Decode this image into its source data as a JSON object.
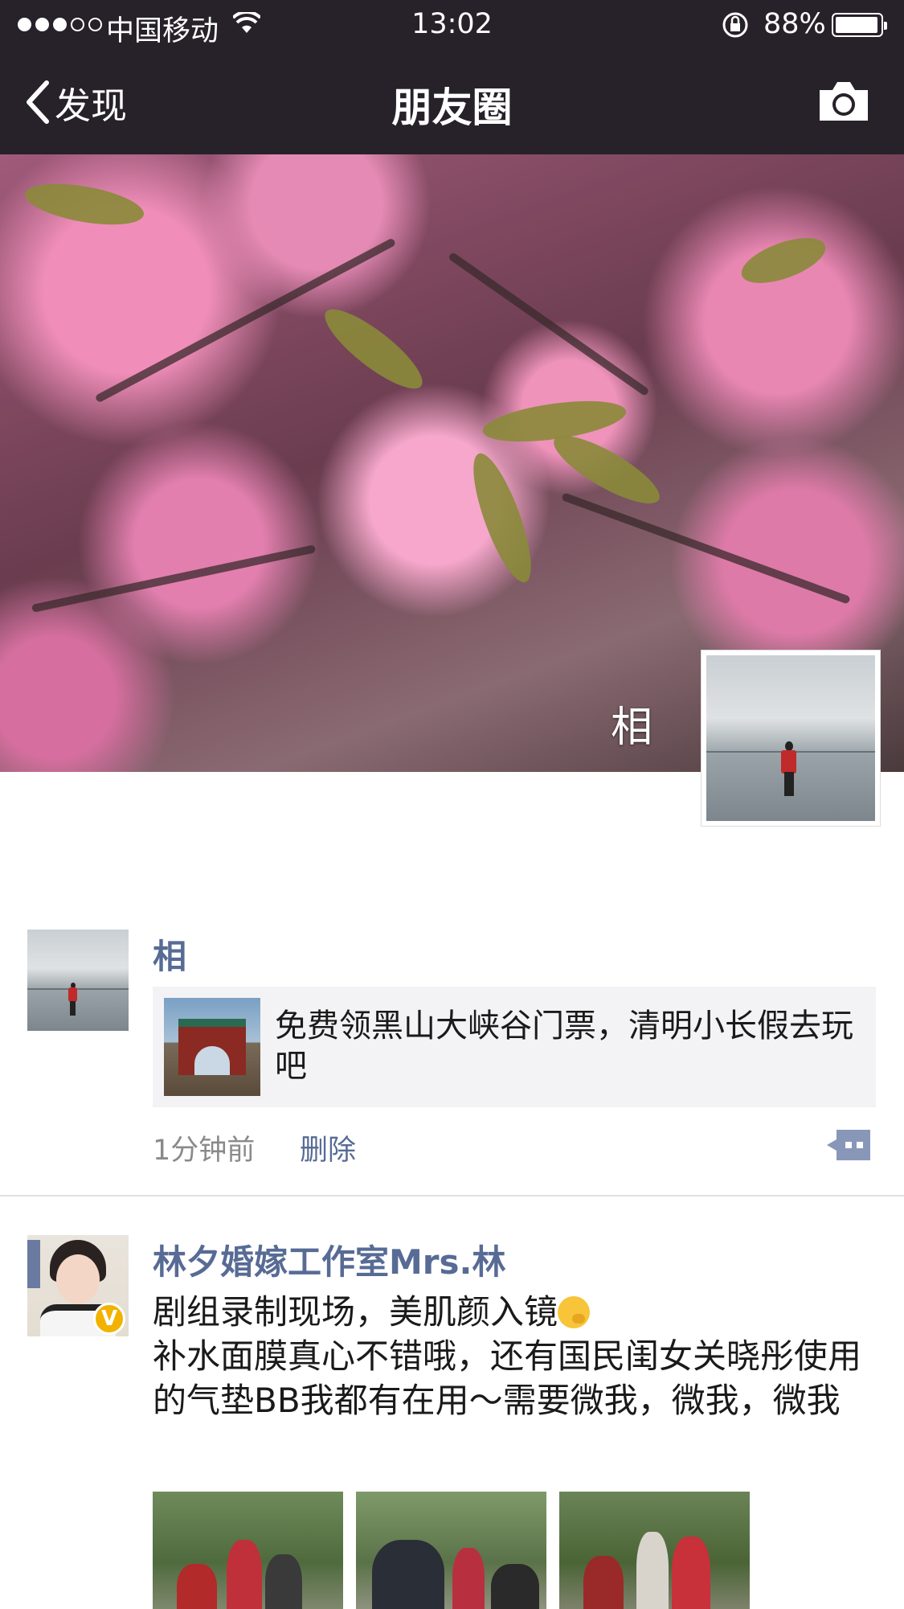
{
  "status_bar": {
    "signal_filled": 3,
    "signal_total": 5,
    "carrier": "中国移动",
    "time": "13:02",
    "battery": "88%",
    "battery_level": 0.88
  },
  "nav": {
    "back_label": "发现",
    "title": "朋友圈",
    "right_icon": "camera-icon"
  },
  "cover": {
    "user_name": "相"
  },
  "posts": [
    {
      "author": "相",
      "share": {
        "title": "免费领黑山大峡谷门票，清明小长假去玩吧"
      },
      "time": "1分钟前",
      "delete_label": "删除",
      "action_icon": "comment-icon"
    },
    {
      "author": "林夕婚嫁工作室Mrs.林",
      "badge": "V",
      "text_line1": "剧组录制现场，美肌颜入镜",
      "text_rest": "补水面膜真心不错哦，还有国民闺女关晓彤使用的气垫BB我都有在用～需要微我，微我，微我",
      "images": 3
    }
  ],
  "colors": {
    "nav_bg": "#27212a",
    "link_blue": "#576b95",
    "meta_gray": "#8a8a8a",
    "share_bg": "#f3f3f5"
  }
}
